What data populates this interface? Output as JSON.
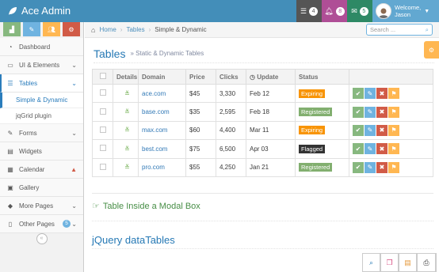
{
  "app": {
    "brand": "Ace Admin"
  },
  "navbar": {
    "tasks_count": "4",
    "notifications_count": "8",
    "messages_count": "5",
    "welcome": "Welcome,",
    "user_name": "Jason",
    "colors": {
      "bar": "#438eb9",
      "tasks": "#555555",
      "notif": "#af4e96",
      "messages": "#2e8965"
    }
  },
  "sidebar": {
    "items": [
      {
        "label": "Dashboard"
      },
      {
        "label": "UI & Elements"
      },
      {
        "label": "Tables"
      },
      {
        "label": "Forms"
      },
      {
        "label": "Widgets"
      },
      {
        "label": "Calendar"
      },
      {
        "label": "Gallery"
      },
      {
        "label": "More Pages"
      },
      {
        "label": "Other Pages",
        "badge": "5"
      }
    ],
    "sub": [
      {
        "label": "Simple & Dynamic"
      },
      {
        "label": "jqGrid plugin"
      }
    ]
  },
  "breadcrumb": {
    "home": "Home",
    "tables": "Tables",
    "current": "Simple & Dynamic"
  },
  "search": {
    "placeholder": "Search ..."
  },
  "page": {
    "title": "Tables",
    "subtitle": "» Static & Dynamic Tables"
  },
  "table": {
    "headers": [
      "Details",
      "Domain",
      "Price",
      "Clicks",
      "Update",
      "Status"
    ],
    "rows": [
      {
        "domain": "ace.com",
        "price": "$45",
        "clicks": "3,330",
        "update": "Feb 12",
        "status": "Expiring"
      },
      {
        "domain": "base.com",
        "price": "$35",
        "clicks": "2,595",
        "update": "Feb 18",
        "status": "Registered"
      },
      {
        "domain": "max.com",
        "price": "$60",
        "clicks": "4,400",
        "update": "Mar 11",
        "status": "Expiring"
      },
      {
        "domain": "best.com",
        "price": "$75",
        "clicks": "6,500",
        "update": "Apr 03",
        "status": "Flagged"
      },
      {
        "domain": "pro.com",
        "price": "$55",
        "clicks": "4,250",
        "update": "Jan 21",
        "status": "Registered"
      }
    ],
    "status_colors": {
      "Expiring": "#f89406",
      "Registered": "#82af6f",
      "Flagged": "#333333"
    }
  },
  "sections": {
    "modal": "Table Inside a Modal Box",
    "datatables": "jQuery dataTables"
  }
}
